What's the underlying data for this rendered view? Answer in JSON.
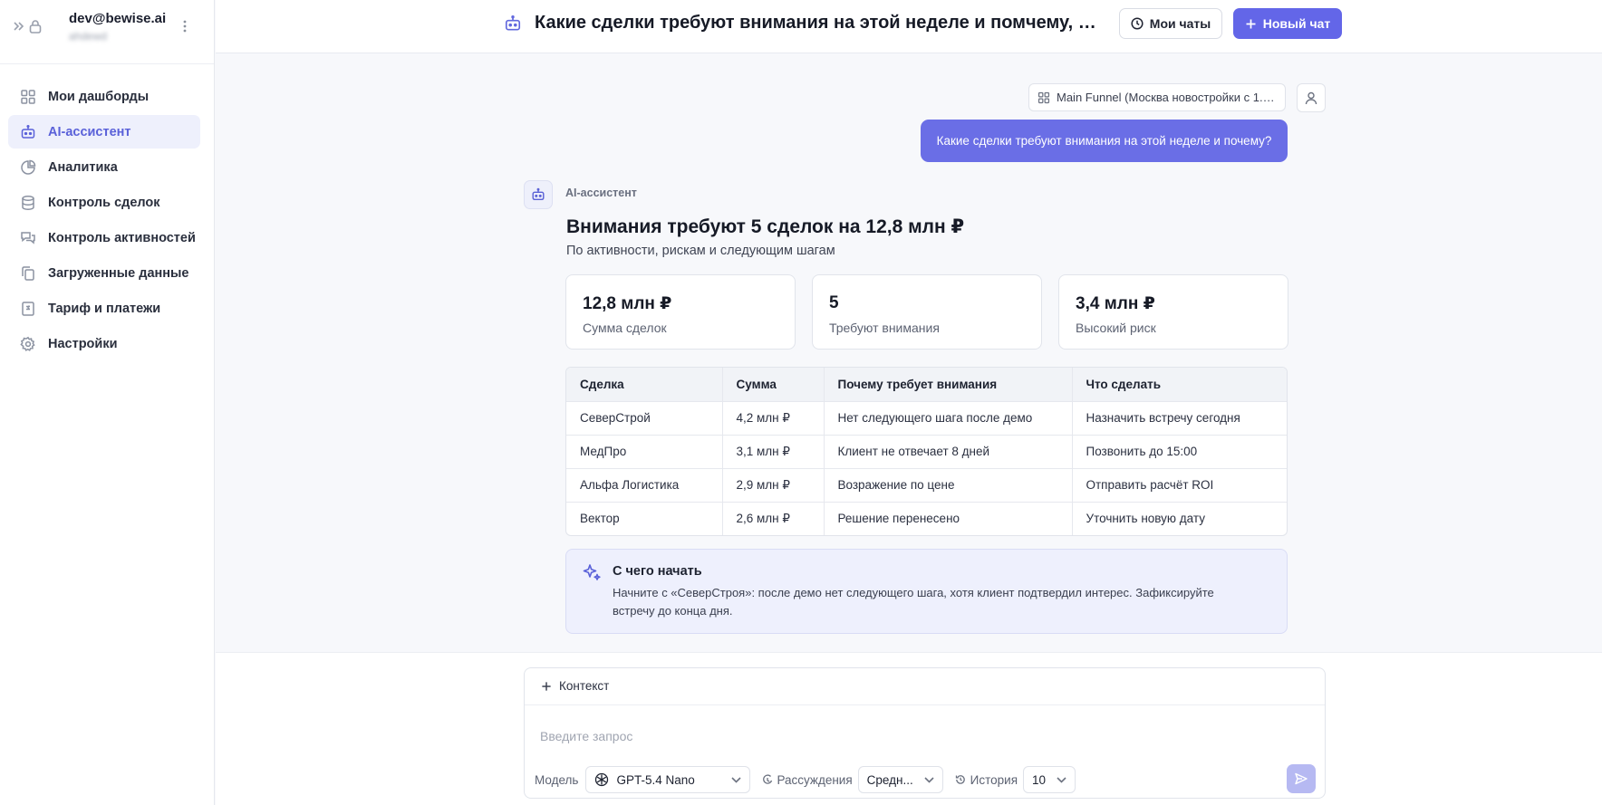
{
  "account": {
    "email": "dev@bewise.ai",
    "org": "ahdewd"
  },
  "nav": {
    "items": [
      {
        "label": "Мои дашборды",
        "icon": "grid-icon"
      },
      {
        "label": "AI-ассистент",
        "icon": "bot-icon",
        "active": true
      },
      {
        "label": "Аналитика",
        "icon": "pie-chart-icon"
      },
      {
        "label": "Контроль сделок",
        "icon": "database-icon"
      },
      {
        "label": "Контроль активностей",
        "icon": "chat-bubbles-icon"
      },
      {
        "label": "Загруженные данные",
        "icon": "files-icon"
      },
      {
        "label": "Тариф и платежи",
        "icon": "receipt-icon"
      },
      {
        "label": "Настройки",
        "icon": "gear-icon"
      }
    ]
  },
  "header": {
    "title": "Какие сделки требуют внимания на этой неделе и помчему, покажи в виде таблицы и дай рекомендации",
    "chats_label": "Мои чаты",
    "new_chat_label": "Новый чат"
  },
  "chat": {
    "context_chip": "Main Funnel (Москва новостройки с 1.0...",
    "user_message": "Какие сделки требуют внимания на этой неделе и почему?",
    "assistant_name": "AI-ассистент",
    "answer_title": "Внимания требуют 5 сделок на 12,8 млн ₽",
    "answer_subtitle": "По активности, рискам и следующим шагам",
    "kpis": [
      {
        "value": "12,8 млн ₽",
        "label": "Сумма сделок"
      },
      {
        "value": "5",
        "label": "Требуют внимания"
      },
      {
        "value": "3,4 млн ₽",
        "label": "Высокий риск"
      }
    ],
    "table": {
      "headers": [
        "Сделка",
        "Сумма",
        "Почему требует внимания",
        "Что сделать"
      ],
      "rows": [
        [
          "СеверСтрой",
          "4,2 млн ₽",
          "Нет следующего шага после демо",
          "Назначить встречу сегодня"
        ],
        [
          "МедПро",
          "3,1 млн ₽",
          "Клиент не отвечает 8 дней",
          "Позвонить до 15:00"
        ],
        [
          "Альфа Логистика",
          "2,9 млн ₽",
          "Возражение по цене",
          "Отправить расчёт ROI"
        ],
        [
          "Вектор",
          "2,6 млн ₽",
          "Решение перенесено",
          "Уточнить новую дату"
        ]
      ]
    },
    "tip": {
      "title": "С чего начать",
      "text": "Начните с «СеверСтроя»: после демо нет следующего шага, хотя клиент подтвердил интерес. Зафиксируйте встречу до конца дня."
    }
  },
  "composer": {
    "context_label": "Контекст",
    "placeholder": "Введите запрос",
    "model_label": "Модель",
    "model_value": "GPT-5.4 Nano",
    "reasoning_label": "Рассуждения",
    "reasoning_value": "Средн...",
    "history_label": "История",
    "history_value": "10"
  },
  "colors": {
    "accent": "#6366e8",
    "active_nav_bg": "#eef0fc",
    "tip_bg": "#eef0fd"
  }
}
